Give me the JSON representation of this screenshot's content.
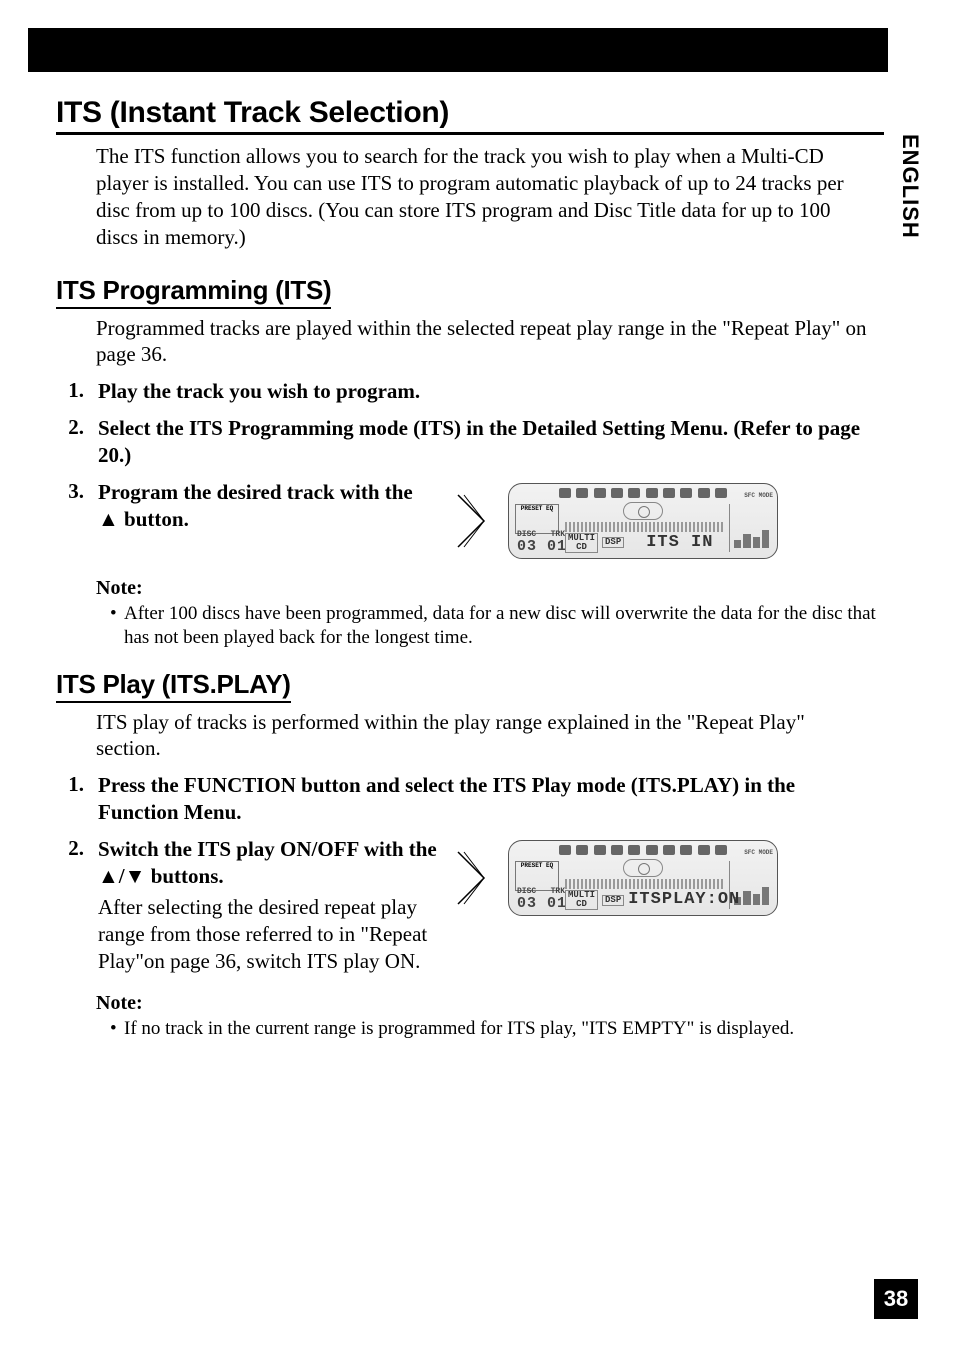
{
  "language_tab": "ENGLISH",
  "page_number": "38",
  "h1": "ITS (Instant Track Selection)",
  "intro": "The ITS function allows you to search for the track you wish to play when a Multi-CD player is installed. You can use ITS to program automatic playback of up to 24 tracks per disc from up to 100 discs. (You can store ITS program and Disc Title data for up to 100 discs in memory.)",
  "section_prog": {
    "heading": "ITS Programming (ITS)",
    "body": "Programmed tracks are played within the selected repeat play range in the \"Repeat Play\" on page 36.",
    "steps": [
      {
        "num": "1.",
        "text": "Play the track you wish to program."
      },
      {
        "num": "2.",
        "text": "Select the ITS Programming mode (ITS) in the Detailed Setting Menu. (Refer to page 20.)"
      },
      {
        "num": "3.",
        "text_a": "Program the desired track with the ",
        "text_b": " button."
      }
    ],
    "note_label": "Note:",
    "note_item": "After 100 discs have been programmed, data for a new disc will overwrite the data for the disc that has not been played back for the longest time."
  },
  "section_play": {
    "heading": "ITS Play (ITS.PLAY)",
    "body": "ITS play of tracks is performed within the play range explained in the \"Repeat Play\" section.",
    "steps": [
      {
        "num": "1.",
        "text": "Press the FUNCTION button and select the ITS Play mode (ITS.PLAY) in the Function Menu."
      },
      {
        "num": "2.",
        "text_a": "Switch the ITS play ON/OFF with the ",
        "text_b": " buttons.",
        "sub": "After selecting the desired repeat play range from those referred to in \"Repeat Play\"on page 36, switch ITS play ON."
      }
    ],
    "note_label": "Note:",
    "note_item": "If no track in the current range is programmed for ITS play, \"ITS EMPTY\" is displayed."
  },
  "lcd1": {
    "preset_label": "PRESET EQ",
    "sfc_label": "SFC MODE",
    "disc_label": "DISC",
    "trk_label": "TRK",
    "disc_val": "03",
    "trk_val": "01",
    "mode1": "MULTI",
    "mode2": "CD",
    "mode3": "DSP",
    "text": "ITS  IN"
  },
  "lcd2": {
    "preset_label": "PRESET EQ",
    "sfc_label": "SFC MODE",
    "disc_label": "DISC",
    "trk_label": "TRK",
    "disc_val": "03",
    "trk_val": "01",
    "mode1": "MULTI",
    "mode2": "CD",
    "mode3": "DSP",
    "text": "ITSPLAY:ON"
  }
}
